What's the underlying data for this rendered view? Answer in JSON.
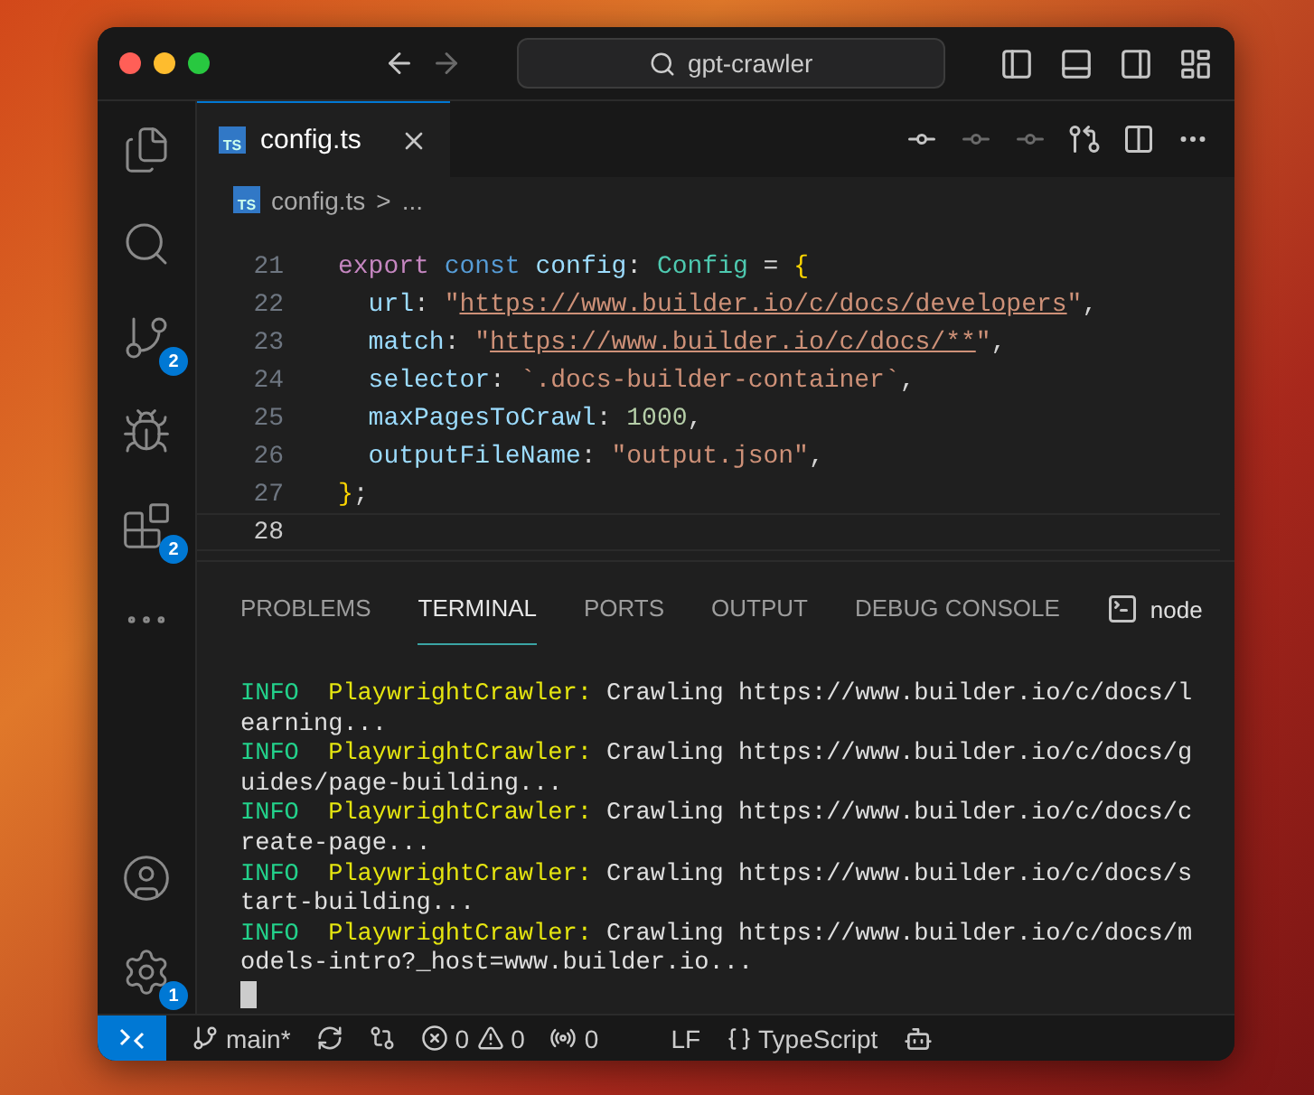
{
  "window": {
    "title": "gpt-crawler"
  },
  "activity_bar": {
    "items": [
      {
        "kind": "files"
      },
      {
        "kind": "search"
      },
      {
        "kind": "source-control",
        "badge": "2"
      },
      {
        "kind": "debug"
      },
      {
        "kind": "extensions",
        "badge": "2"
      },
      {
        "kind": "more"
      }
    ],
    "bottom": [
      {
        "kind": "account"
      },
      {
        "kind": "settings",
        "badge": "1"
      }
    ]
  },
  "editor_tabs": [
    {
      "label": "config.ts",
      "icon": "TS",
      "selected": true
    }
  ],
  "breadcrumbs": {
    "icon": "TS",
    "file": "config.ts",
    "separator": ">",
    "rest": "..."
  },
  "editor": {
    "lines": [
      {
        "number": "21",
        "current": false,
        "tokens": [
          {
            "kind": "keyword",
            "text": "export"
          },
          {
            "kind": "storage",
            "text": " const "
          },
          {
            "kind": "variable",
            "text": "config"
          },
          {
            "kind": "punct",
            "text": ": "
          },
          {
            "kind": "type",
            "text": "Config"
          },
          {
            "kind": "punct",
            "text": " = "
          },
          {
            "kind": "brace",
            "text": "{"
          }
        ]
      },
      {
        "number": "22",
        "current": false,
        "tokens": [
          {
            "kind": "prop",
            "text": "  url"
          },
          {
            "kind": "punct",
            "text": ": "
          },
          {
            "kind": "string",
            "text": "\""
          },
          {
            "kind": "url",
            "text": "https://www.builder.io/c/docs/developers"
          },
          {
            "kind": "string",
            "text": "\""
          },
          {
            "kind": "punct",
            "text": ","
          }
        ]
      },
      {
        "number": "23",
        "current": false,
        "tokens": [
          {
            "kind": "prop",
            "text": "  match"
          },
          {
            "kind": "punct",
            "text": ": "
          },
          {
            "kind": "string",
            "text": "\""
          },
          {
            "kind": "url",
            "text": "https://www.builder.io/c/docs/**"
          },
          {
            "kind": "string",
            "text": "\""
          },
          {
            "kind": "punct",
            "text": ","
          }
        ]
      },
      {
        "number": "24",
        "current": false,
        "tokens": [
          {
            "kind": "prop",
            "text": "  selector"
          },
          {
            "kind": "punct",
            "text": ": "
          },
          {
            "kind": "string",
            "text": "`.docs-builder-container`"
          },
          {
            "kind": "punct",
            "text": ","
          }
        ]
      },
      {
        "number": "25",
        "current": false,
        "tokens": [
          {
            "kind": "prop",
            "text": "  maxPagesToCrawl"
          },
          {
            "kind": "punct",
            "text": ": "
          },
          {
            "kind": "number",
            "text": "1000"
          },
          {
            "kind": "punct",
            "text": ","
          }
        ]
      },
      {
        "number": "26",
        "current": false,
        "tokens": [
          {
            "kind": "prop",
            "text": "  outputFileName"
          },
          {
            "kind": "punct",
            "text": ": "
          },
          {
            "kind": "string",
            "text": "\"output.json\""
          },
          {
            "kind": "punct",
            "text": ","
          }
        ]
      },
      {
        "number": "27",
        "current": false,
        "tokens": [
          {
            "kind": "brace",
            "text": "}"
          },
          {
            "kind": "punct",
            "text": ";"
          }
        ]
      },
      {
        "number": "28",
        "current": true
      }
    ]
  },
  "panel": {
    "tabs": [
      {
        "label": "PROBLEMS",
        "selected": false
      },
      {
        "label": "TERMINAL",
        "selected": true
      },
      {
        "label": "PORTS",
        "selected": false
      },
      {
        "label": "OUTPUT",
        "selected": false
      },
      {
        "label": "DEBUG CONSOLE",
        "selected": false
      }
    ],
    "terminal_name": "node",
    "log": [
      {
        "level": "INFO",
        "source": "PlaywrightCrawler:",
        "message": "Crawling https://www.builder.io/c/docs/learning..."
      },
      {
        "level": "INFO",
        "source": "PlaywrightCrawler:",
        "message": "Crawling https://www.builder.io/c/docs/guides/page-building..."
      },
      {
        "level": "INFO",
        "source": "PlaywrightCrawler:",
        "message": "Crawling https://www.builder.io/c/docs/create-page..."
      },
      {
        "level": "INFO",
        "source": "PlaywrightCrawler:",
        "message": "Crawling https://www.builder.io/c/docs/start-building..."
      },
      {
        "level": "INFO",
        "source": "PlaywrightCrawler:",
        "message": "Crawling https://www.builder.io/c/docs/models-intro?_host=www.builder.io..."
      }
    ]
  },
  "status_bar": {
    "branch": "main*",
    "errors": "0",
    "warnings": "0",
    "ports": "0",
    "eol": "LF",
    "language": "TypeScript"
  }
}
